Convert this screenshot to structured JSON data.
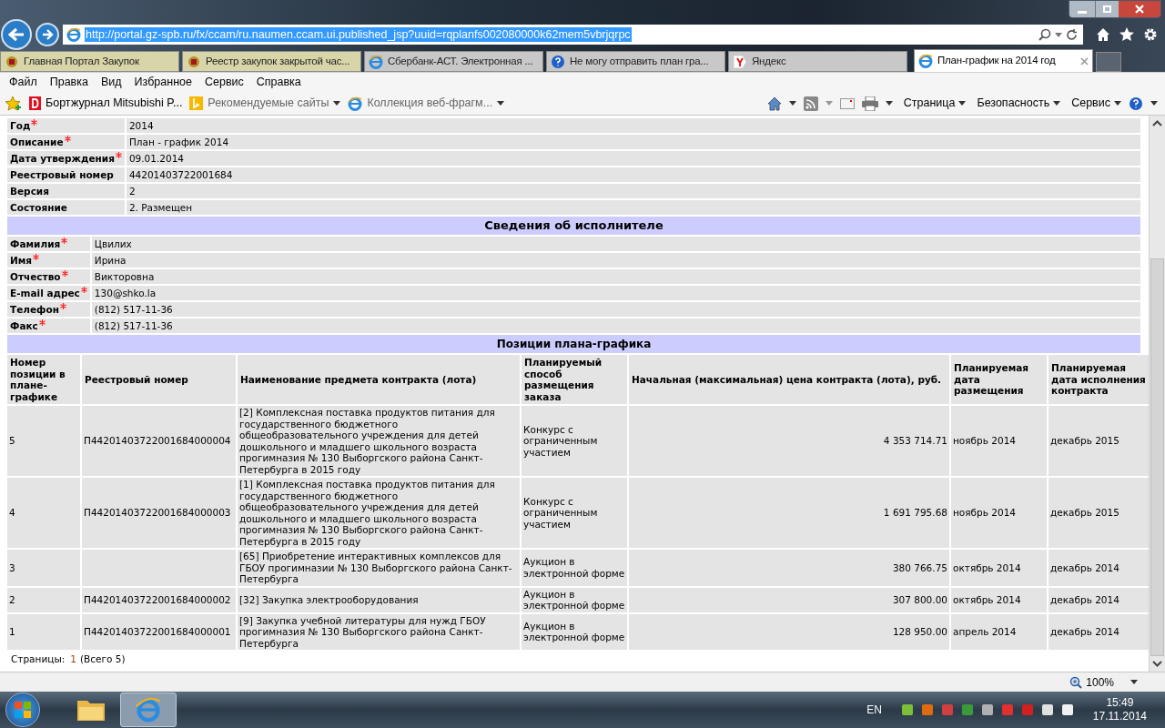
{
  "browser": {
    "address": "http://portal.gz-spb.ru/fx/ccam/ru.naumen.ccam.ui.published_jsp?uuid=rqplanfs002080000k62mem5vbrjqrpc",
    "tabs": [
      {
        "title": "Главная Портал Закупок",
        "selected": false,
        "color": "#d8d5a8"
      },
      {
        "title": "Реестр закупок закрытой час...",
        "selected": false,
        "color": "#d8d5a8"
      },
      {
        "title": "Сбербанк-АСТ. Электронная ...",
        "selected": false,
        "color": "#c8c8c8"
      },
      {
        "title": "Не могу отправить план гра...",
        "selected": false,
        "color": "#c8c8c8"
      },
      {
        "title": "Яндекс",
        "selected": false,
        "color": "#c8c8c8"
      },
      {
        "title": "План-график на 2014 год",
        "selected": true,
        "color": "#ffffff"
      }
    ],
    "menu": [
      "Файл",
      "Правка",
      "Вид",
      "Избранное",
      "Сервис",
      "Справка"
    ],
    "favorites": [
      {
        "label": "Бортжурнал Mitsubishi P...",
        "dropdown": false
      },
      {
        "label": "Рекомендуемые сайты",
        "dropdown": true
      },
      {
        "label": "Коллекция веб-фрагм...",
        "dropdown": true
      }
    ],
    "commands": [
      "Страница",
      "Безопасность",
      "Сервис"
    ],
    "zoom": "100%"
  },
  "plan": {
    "fields": [
      {
        "label": "Год",
        "required": true,
        "value": "2014"
      },
      {
        "label": "Описание",
        "required": true,
        "value": "План - график 2014"
      },
      {
        "label": "Дата утверждения",
        "required": true,
        "value": "09.01.2014"
      },
      {
        "label": "Реестровый номер",
        "required": false,
        "value": "44201403722001684"
      },
      {
        "label": "Версия",
        "required": false,
        "value": "2"
      },
      {
        "label": "Состояние",
        "required": false,
        "value": "2. Размещен"
      }
    ]
  },
  "executor": {
    "title": "Сведения об исполнителе",
    "fields": [
      {
        "label": "Фамилия",
        "required": true,
        "value": "Цвилих"
      },
      {
        "label": "Имя",
        "required": true,
        "value": "Ирина"
      },
      {
        "label": "Отчество",
        "required": true,
        "value": "Викторовна"
      },
      {
        "label": "E-mail адрес",
        "required": true,
        "value": "130@shko.la"
      },
      {
        "label": "Телефон",
        "required": true,
        "value": "(812) 517-11-36"
      },
      {
        "label": "Факс",
        "required": true,
        "value": "(812) 517-11-36"
      }
    ]
  },
  "positions": {
    "title": "Позиции плана-графика",
    "columns": [
      "Номер позиции в плане-графике",
      "Реестровый номер",
      "Наименование предмета контракта (лота)",
      "Планируемый способ размещения заказа",
      "Начальная (максимальная) цена контракта (лота), руб.",
      "Планируемая дата размещения",
      "Планируемая дата исполнения контракта"
    ],
    "rows": [
      [
        "5",
        "П44201403722001684000004",
        "[2] Комплексная поставка продуктов питания для государственного бюджетного общеобразовательного учреждения для детей дошкольного и младшего школьного возраста прогимназия № 130 Выборгского района Санкт-Петербурга в 2015 году",
        "Конкурс с ограниченным участием",
        "4 353 714.71",
        "ноябрь 2014",
        "декабрь 2015"
      ],
      [
        "4",
        "П44201403722001684000003",
        "[1] Комплексная поставка продуктов питания для государственного бюджетного общеобразовательного учреждения для детей дошкольного и младшего школьного возраста прогимназия № 130 Выборгского района Санкт-Петербурга в 2015 году",
        "Конкурс с ограниченным участием",
        "1 691 795.68",
        "ноябрь 2014",
        "декабрь 2015"
      ],
      [
        "3",
        "",
        "[65] Приобретение интерактивных комплексов для ГБОУ прогимназии № 130 Выборгского района Санкт-Петербурга",
        "Аукцион в электронной форме",
        "380 766.75",
        "октябрь 2014",
        "декабрь 2014"
      ],
      [
        "2",
        "П44201403722001684000002",
        "[32] Закупка электрооборудования",
        "Аукцион в электронной форме",
        "307 800.00",
        "октябрь 2014",
        "декабрь 2014"
      ],
      [
        "1",
        "П44201403722001684000001",
        "[9] Закупка учебной литературы для нужд ГБОУ прогимназия № 130 Выборгского района Санкт-Петербурга",
        "Аукцион в электронной форме",
        "128 950.00",
        "апрель 2014",
        "декабрь 2014"
      ]
    ]
  },
  "pagination": {
    "label": "Страницы:",
    "current": "1",
    "total": "(Всего 5)"
  },
  "taskbar": {
    "language": "EN",
    "time": "15:49",
    "date": "17.11.2014"
  }
}
